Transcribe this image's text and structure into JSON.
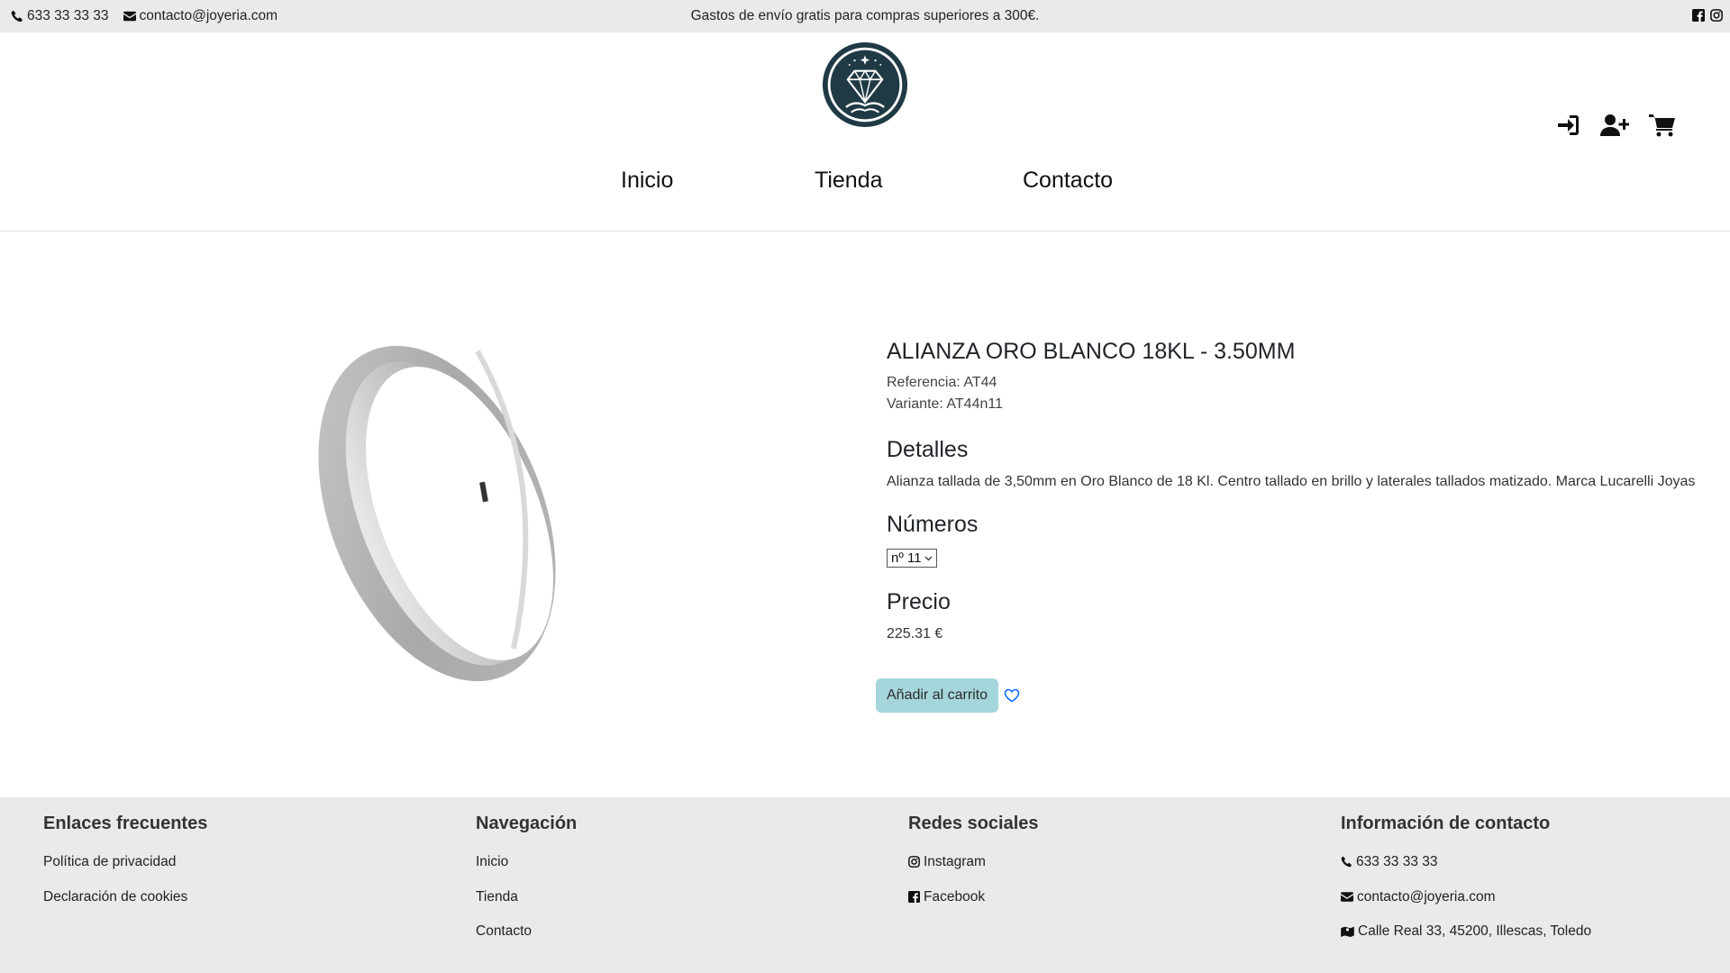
{
  "topbar": {
    "phone": "633 33 33 33",
    "email": "contacto@joyeria.com",
    "promo": "Gastos de envío gratis para compras superiores a 300€.",
    "social_icons": [
      "facebook-icon",
      "instagram-icon"
    ]
  },
  "nav": {
    "items": [
      {
        "label": "Inicio"
      },
      {
        "label": "Tienda"
      },
      {
        "label": "Contacto"
      }
    ]
  },
  "header_actions": [
    "login-icon",
    "register-user-icon",
    "cart-icon"
  ],
  "product": {
    "title": "ALIANZA ORO BLANCO 18KL - 3.50MM",
    "reference": "Referencia: AT44",
    "variant": "Variante: AT44n11",
    "details_heading": "Detalles",
    "details_text": "Alianza tallada de 3,50mm en Oro Blanco de 18 Kl. Centro tallado en brillo y laterales tallados matizado. Marca Lucarelli Joyas",
    "numbers_heading": "Números",
    "size_selected": "nº 11",
    "price_heading": "Precio",
    "price": "225.31 €",
    "add_to_cart": "Añadir al carrito"
  },
  "footer": {
    "frequent": {
      "heading": "Enlaces frecuentes",
      "links": [
        "Política de privacidad",
        "Declaración de cookies"
      ]
    },
    "navigation": {
      "heading": "Navegación",
      "links": [
        "Inicio",
        "Tienda",
        "Contacto"
      ]
    },
    "social": {
      "heading": "Redes sociales",
      "links": [
        "Instagram",
        "Facebook"
      ]
    },
    "contact": {
      "heading": "Información de contacto",
      "phone": "633 33 33 33",
      "email": "contacto@joyeria.com",
      "address": "Calle Real 33, 45200, Illescas, Toledo"
    }
  },
  "colors": {
    "topbar_bg": "#ebe9e9",
    "footer_bg": "#ebe9e9",
    "cart_button_bg": "#a4d6dc",
    "logo_dark": "#1f3a44",
    "wishlist_blue": "#0d6efd"
  }
}
